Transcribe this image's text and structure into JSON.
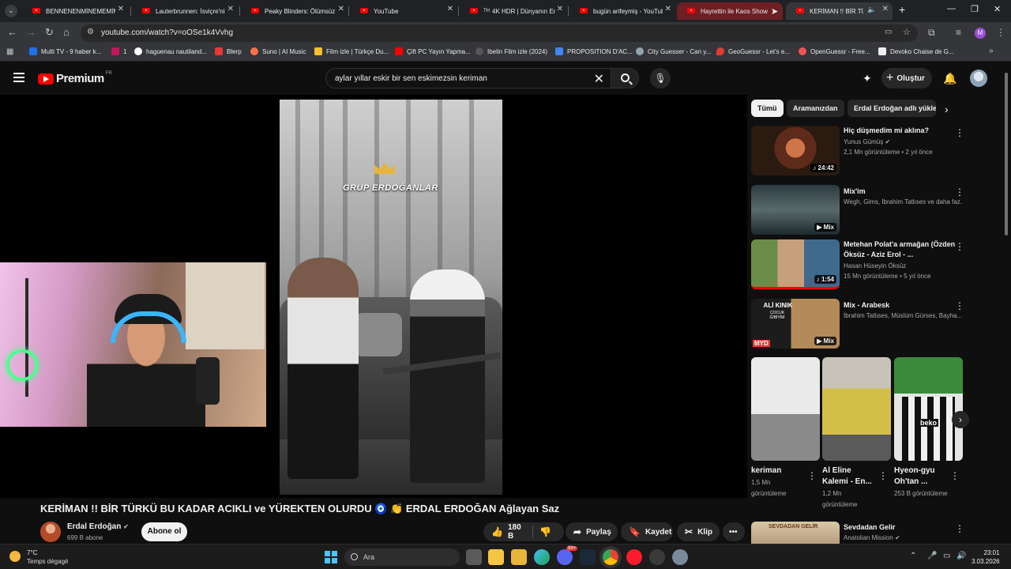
{
  "browser": {
    "tabs": [
      {
        "title": "BENNENENMİNEMEMİMİ"
      },
      {
        "title": "Lauterbrunnen: İsviçre'nin"
      },
      {
        "title": "Peaky Blinders: Ölümsüz A"
      },
      {
        "title": "YouTube"
      },
      {
        "title": "4K HDR | Dünyanın En"
      },
      {
        "title": "bugün arifeymiş - YouTube"
      },
      {
        "title": "Hayrettin ile Kaos Show"
      },
      {
        "title": "KERİMAN !! BİR TÜRKÜ"
      }
    ],
    "tab_badge": "TH",
    "url": "youtube.com/watch?v=oOSe1k4Vvhg",
    "profile_initial": "M",
    "bookmarks": [
      {
        "label": "Multi TV - 9 haber k..."
      },
      {
        "label": "1"
      },
      {
        "label": "haguenau nautiland..."
      },
      {
        "label": "Blerp"
      },
      {
        "label": "Suno | AI Music"
      },
      {
        "label": "Film izle | Türkçe Du..."
      },
      {
        "label": "Çift PC Yayın Yapma..."
      },
      {
        "label": "Ibelin Film izle (2024)"
      },
      {
        "label": "PROPOSITION D'AC..."
      },
      {
        "label": "City Guesser - Can y..."
      },
      {
        "label": "GeoGuessr - Let's e..."
      },
      {
        "label": "OpenGuessr - Free..."
      },
      {
        "label": "Devoko Chaise de G..."
      }
    ]
  },
  "youtube": {
    "logo_text": "Premium",
    "logo_region": "FR",
    "search_query": "aylar yıllar eskir bir sen eskimezsin keriman",
    "create_label": "Oluştur",
    "video_watermark": "GRUP ERDOĞANLAR",
    "video": {
      "title": "KERİMAN !! BİR TÜRKÜ BU KADAR ACIKLI ve YÜREKTEN OLURDU 🧿 👏 ERDAL ERDOĞAN Ağlayan Saz",
      "channel": "Erdal Erdoğan",
      "subscribers": "699 B abone",
      "subscribe_label": "Abone ol",
      "likes": "180 B",
      "share_label": "Paylaş",
      "save_label": "Kaydet",
      "clip_label": "Klip"
    },
    "chips": [
      {
        "label": "Tümü"
      },
      {
        "label": "Aramanızdan"
      },
      {
        "label": "Erdal Erdoğan adlı yükle"
      }
    ],
    "recommendations": [
      {
        "title": "Hiç düşmedim mi aklına?",
        "channel": "Yunus Gümüş",
        "meta": "2,1 Mn görüntüleme • 2 yıl önce",
        "badge": "24:42"
      },
      {
        "title": "Mix'im",
        "channel": "Wegh, Gims, İbrahim Tatlıses ve daha faz...",
        "meta": "",
        "badge": "Mix"
      },
      {
        "title": "Metehan Polat'a armağan (Özden Öksüz - Aziz Erol - ...",
        "channel": "Hasan Hüseyin Öksüz",
        "meta": "15 Mn görüntüleme • 5 yıl önce",
        "badge": "1:54"
      },
      {
        "title": "Mix - Arabesk",
        "channel": "İbrahim Tatlıses, Müslüm Gürses, Bayha...",
        "meta": "",
        "badge": "Mix"
      }
    ],
    "thumb_text": {
      "mix_arabesk_top": "ALİ KINIK",
      "mix_arabesk_sub": "ÇOCUK GİBİYİM",
      "mix_arabesk_brand": "MYD",
      "shorts_jersey": "beko"
    },
    "shorts": [
      {
        "title": "keriman",
        "views": "1,5 Mn görüntüleme"
      },
      {
        "title": "Al Eline Kalemi - En...",
        "views": "1,2 Mn görüntüleme"
      },
      {
        "title": "Hyeon-gyu Oh'tan ...",
        "views": "253 B görüntüleme"
      }
    ],
    "last_rec": {
      "title": "Sevdadan Gelir",
      "channel": "Anatolian Mission",
      "thumb_text": "SEVDADAN GELİR"
    }
  },
  "taskbar": {
    "temp": "7°C",
    "weather": "Temps dégagé",
    "search_label": "Ara",
    "time": "23:01",
    "date": "3.03.2026",
    "notif_badge": "99+"
  },
  "colors": {
    "yt_red": "#ff0000",
    "bg": "#0f0f0f",
    "chip_bg": "#272727",
    "highlight_tab": "#6d1f24"
  }
}
